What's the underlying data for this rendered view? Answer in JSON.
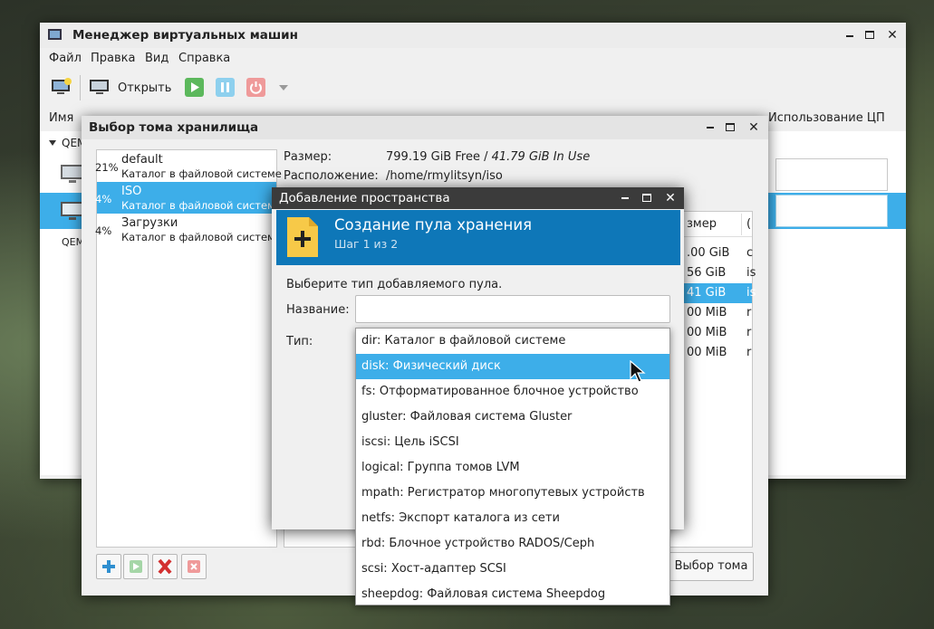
{
  "main_window": {
    "title": "Менеджер виртуальных машин",
    "menu": [
      "Файл",
      "Правка",
      "Вид",
      "Справка"
    ],
    "toolbar": {
      "open_label": "Открыть"
    },
    "columns": {
      "name": "Имя",
      "cpu": "Использование ЦП"
    },
    "tree_item": "QEM",
    "vm_label": "QEM"
  },
  "storage_dialog": {
    "title": "Выбор тома хранилища",
    "pools": [
      {
        "pct": "21%",
        "name": "default",
        "type": "Каталог в файловой системе"
      },
      {
        "pct": "4%",
        "name": "ISO",
        "type": "Каталог в файловой системе",
        "selected": true
      },
      {
        "pct": "4%",
        "name": "Загрузки",
        "type": "Каталог в файловой системе"
      }
    ],
    "size_label": "Размер:",
    "size_free": "799.19 GiB Free",
    "size_sep": " / ",
    "size_inuse": "41.79 GiB In Use",
    "location_label": "Расположение:",
    "location_value": "/home/rmylitsyn/iso",
    "volume_header": "змер",
    "volume_header2": "(",
    "volume_sizes": [
      ".00 GiB",
      "56 GiB",
      "41 GiB",
      "00 MiB",
      "00 MiB",
      "00 MiB"
    ],
    "volume_formats": [
      "c",
      "is",
      "is",
      "r",
      "r",
      "r"
    ],
    "choose_button": "Выбор тома"
  },
  "add_pool_dialog": {
    "title": "Добавление пространства",
    "banner_title": "Создание пула хранения",
    "banner_step": "Шаг 1 из 2",
    "prompt": "Выберите тип добавляемого пула.",
    "name_label": "Название:",
    "name_value": "",
    "type_label": "Тип:"
  },
  "type_options": [
    "dir: Каталог в файловой системе",
    "disk: Физический диск",
    "fs: Отформатированное блочное устройство",
    "gluster: Файловая система Gluster",
    "iscsi: Цель iSCSI",
    "logical: Группа томов LVM",
    "mpath: Регистратор многопутевых устройств",
    "netfs: Экспорт каталога из сети",
    "rbd: Блочное устройство RADOS/Ceph",
    "scsi: Хост-адаптер SCSI",
    "sheepdog: Файловая система Sheepdog"
  ],
  "colors": {
    "selection": "#3daee9",
    "banner": "#0e77b8",
    "dialog_titlebar": "#3b3b3b",
    "run_green": "#5cb85c",
    "pause_blue": "#5bc0de",
    "stop_red": "#e57373"
  }
}
